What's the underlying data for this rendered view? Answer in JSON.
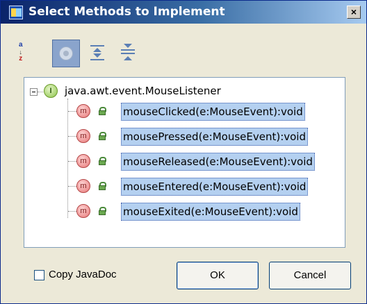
{
  "window": {
    "title": "Select Methods to Implement",
    "close_glyph": "×"
  },
  "toolbar": {
    "buttons": [
      {
        "name": "sort-alphabetically",
        "icon": "sort-az-icon",
        "glyph_top": "a",
        "glyph_bottom": "z",
        "pressed": false
      },
      {
        "name": "show-inherited",
        "icon": "inherited-circle-icon",
        "pressed": true
      },
      {
        "name": "expand-all",
        "icon": "expand-all-icon",
        "pressed": false
      },
      {
        "name": "collapse-all",
        "icon": "collapse-all-icon",
        "pressed": false
      }
    ]
  },
  "tree": {
    "root": {
      "label": "java.awt.event.MouseListener",
      "icon": "interface-icon",
      "icon_letter": "I",
      "expanded": true
    },
    "methods": [
      {
        "label": "mouseClicked(e:MouseEvent):void",
        "icon_letter": "m",
        "selected": true
      },
      {
        "label": "mousePressed(e:MouseEvent):void",
        "icon_letter": "m",
        "selected": true
      },
      {
        "label": "mouseReleased(e:MouseEvent):void",
        "icon_letter": "m",
        "selected": true
      },
      {
        "label": "mouseEntered(e:MouseEvent):void",
        "icon_letter": "m",
        "selected": true
      },
      {
        "label": "mouseExited(e:MouseEvent):void",
        "icon_letter": "m",
        "selected": true
      }
    ]
  },
  "footer": {
    "copy_javadoc": {
      "label": "Copy JavaDoc",
      "checked": false
    },
    "ok_label": "OK",
    "cancel_label": "Cancel"
  },
  "colors": {
    "titlebar_start": "#0a246a",
    "titlebar_end": "#a6caf0",
    "dialog_bg": "#ece9d8",
    "selection_bg": "#b4d0f0"
  }
}
